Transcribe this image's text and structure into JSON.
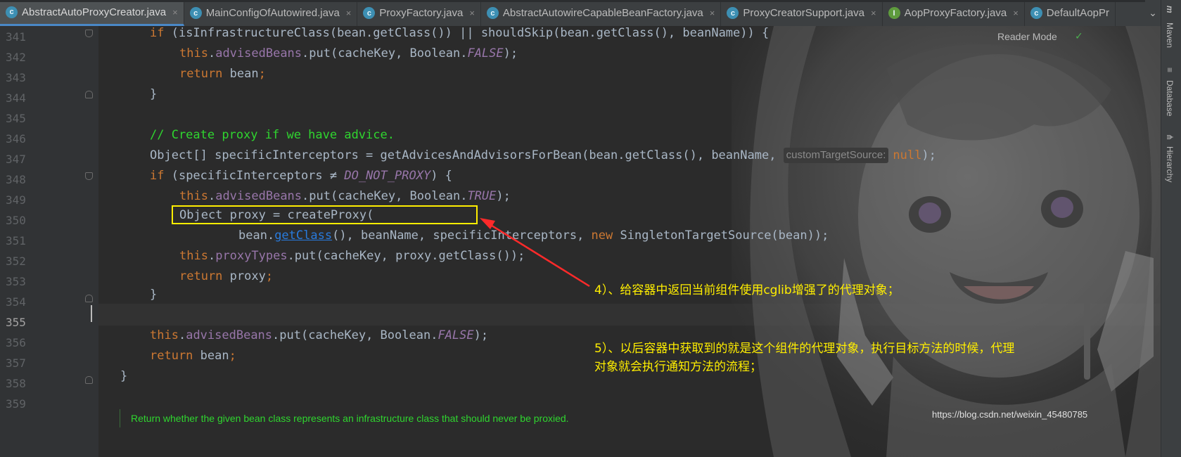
{
  "tabs": [
    {
      "label": "AbstractAutoProxyCreator.java",
      "icon": "class-icon",
      "active": true
    },
    {
      "label": "MainConfigOfAutowired.java",
      "icon": "class-icon",
      "active": false
    },
    {
      "label": "ProxyFactory.java",
      "icon": "class-icon",
      "active": false
    },
    {
      "label": "AbstractAutowireCapableBeanFactory.java",
      "icon": "class-icon",
      "active": false
    },
    {
      "label": "ProxyCreatorSupport.java",
      "icon": "class-icon",
      "active": false
    },
    {
      "label": "AopProxyFactory.java",
      "icon": "interface-icon",
      "active": false
    },
    {
      "label": "DefaultAopPr",
      "icon": "class-icon",
      "active": false
    }
  ],
  "tab_close_glyph": "×",
  "tab_overflow_glyph": "⌄",
  "reader_mode": {
    "label": "Reader Mode",
    "check_glyph": "✓"
  },
  "right_tools": [
    "Maven",
    "Database",
    "Hierarchy"
  ],
  "current_line": 355,
  "line_numbers": [
    "341",
    "342",
    "343",
    "344",
    "345",
    "346",
    "347",
    "348",
    "349",
    "350",
    "351",
    "352",
    "353",
    "354",
    "355",
    "356",
    "357",
    "358",
    "359"
  ],
  "code": {
    "l341": {
      "kw_if": "if",
      "p1": " (isInfrastructureClass(bean.getClass()) || shouldSkip(bean.getClass(), beanName)) {"
    },
    "l342": {
      "kw_this": "this",
      "dot": ".",
      "field": "advisedBeans",
      "p1": ".put(cacheKey, Boolean.",
      "const": "FALSE",
      "p2": ");"
    },
    "l343": {
      "kw_return": "return",
      "p1": " bean",
      "semi": ";"
    },
    "l344": {
      "p1": "}"
    },
    "l346": {
      "comment": "// Create proxy if we have advice."
    },
    "l347": {
      "p1": "Object[] specificInterceptors = getAdvicesAndAdvisorsForBean(bean.getClass(), beanName, ",
      "hint": "customTargetSource:",
      "kw_null": "null",
      "p2": ");"
    },
    "l348": {
      "kw_if": "if",
      "p1": " (specificInterceptors ≠ ",
      "const": "DO_NOT_PROXY",
      "p2": ") {"
    },
    "l349": {
      "kw_this": "this",
      "dot": ".",
      "field": "advisedBeans",
      "p1": ".put(cacheKey, Boolean.",
      "const": "TRUE",
      "p2": ");"
    },
    "l350": {
      "p1": "Object proxy = createProxy("
    },
    "l351": {
      "p1": "bean.",
      "link": "getClass",
      "p2": "(), beanName, specificInterceptors, ",
      "kw_new": "new",
      "p3": " SingletonTargetSource(bean));"
    },
    "l352": {
      "kw_this": "this",
      "dot": ".",
      "field": "proxyTypes",
      "p1": ".put(cacheKey, proxy.getClass());"
    },
    "l353": {
      "kw_return": "return",
      "p1": " proxy",
      "semi": ";"
    },
    "l354": {
      "p1": "}"
    },
    "l356": {
      "kw_this": "this",
      "dot": ".",
      "field": "advisedBeans",
      "p1": ".put(cacheKey, Boolean.",
      "const": "FALSE",
      "p2": ");"
    },
    "l357": {
      "kw_return": "return",
      "p1": " bean",
      "semi": ";"
    },
    "l358": {
      "p1": "}"
    }
  },
  "annotations": {
    "note4": "4）、给容器中返回当前组件使用cglib增强了的代理对象；",
    "note5_line1": "5）、以后容器中获取到的就是这个组件的代理对象，执行目标方法的时候，代理",
    "note5_line2": "对象就会执行通知方法的流程；",
    "highlight_color": "#ffee00",
    "arrow_color": "#ff2a2a"
  },
  "doc_footer": "Return whether the given bean class represents an infrastructure class that should never be proxied.",
  "watermark": "https://blog.csdn.net/weixin_45480785",
  "colors": {
    "editor_bg": "#2b2b2b",
    "keyword": "#cc7832",
    "field": "#9876aa",
    "comment": "#2fd52f",
    "text": "#a9b7c6",
    "tab_active_underline": "#4a88c7"
  }
}
